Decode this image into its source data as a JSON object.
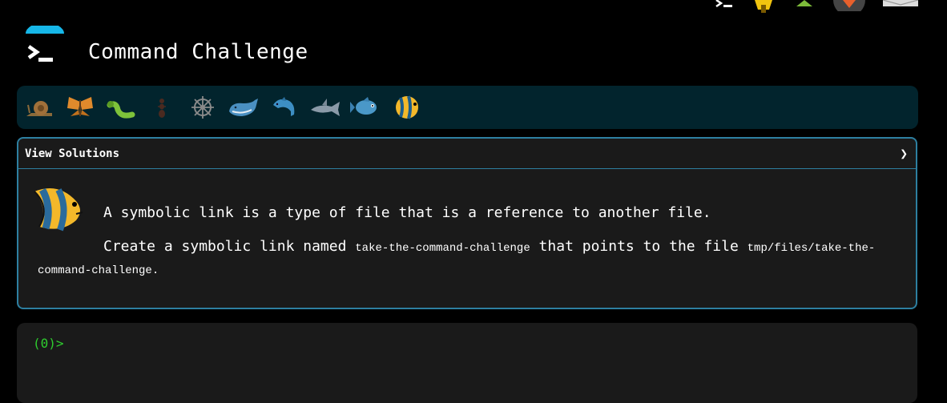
{
  "header": {
    "title": "Command Challenge",
    "top_icons": [
      "terminal-icon",
      "lightbulb-icon",
      "tree-icon",
      "avatar-icon",
      "mail-icon"
    ]
  },
  "levels": {
    "icons": [
      "snail-icon",
      "butterfly-icon",
      "caterpillar-icon",
      "ant-icon",
      "wheel-icon",
      "whale-icon",
      "dolphin-icon",
      "shark-icon",
      "fish-icon",
      "tropical-fish-icon"
    ]
  },
  "panel": {
    "header": "View Solutions",
    "chevron": "❯",
    "description": "A symbolic link is a type of file that is a reference to another file.",
    "task_prefix": "Create a symbolic link named ",
    "task_code1": "take-the-command-challenge",
    "task_middle": " that points to the file ",
    "task_code2": "tmp/files/take-the-command-challenge",
    "task_suffix": "."
  },
  "terminal": {
    "prompt": "(0)>"
  },
  "colors": {
    "accent": "#2d7fa0",
    "level_bar_bg": "#02242d",
    "prompt": "#2ecc2e"
  }
}
